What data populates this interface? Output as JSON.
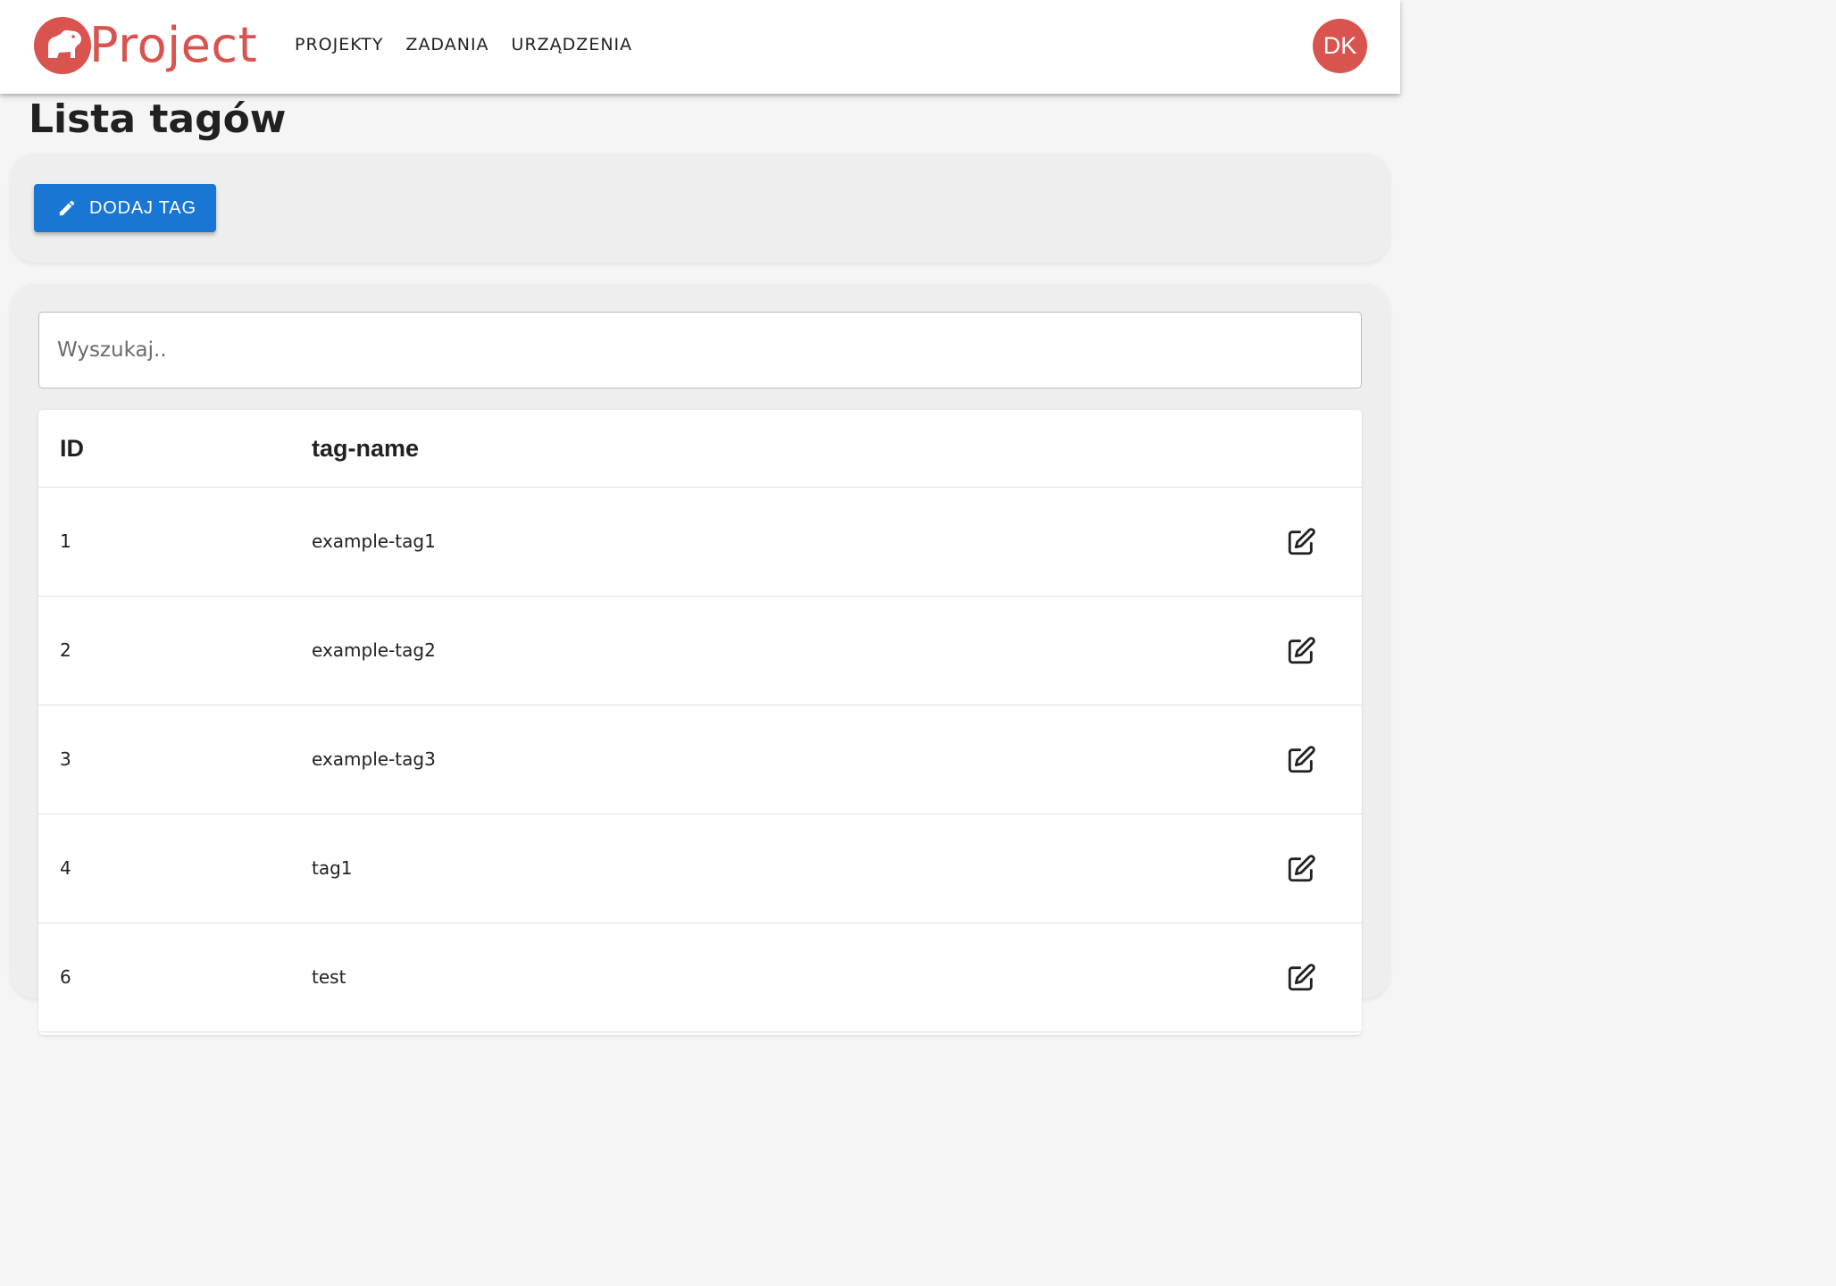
{
  "app": {
    "logo_text": "Project",
    "user_initials": "DK"
  },
  "nav": {
    "items": [
      {
        "label": "PROJEKTY"
      },
      {
        "label": "ZADANIA"
      },
      {
        "label": "URZĄDZENIA"
      }
    ]
  },
  "page": {
    "title": "Lista tagów",
    "add_button_label": "DODAJ TAG"
  },
  "search": {
    "placeholder": "Wyszukaj..",
    "value": ""
  },
  "table": {
    "columns": [
      "ID",
      "tag-name"
    ],
    "rows": [
      {
        "id": "1",
        "name": "example-tag1"
      },
      {
        "id": "2",
        "name": "example-tag2"
      },
      {
        "id": "3",
        "name": "example-tag3"
      },
      {
        "id": "4",
        "name": "tag1"
      },
      {
        "id": "6",
        "name": "test"
      }
    ]
  },
  "colors": {
    "brand": "#d9534f",
    "primary_button": "#1976d2"
  },
  "icons": {
    "add_button": "pencil-icon",
    "row_action": "edit-icon"
  }
}
